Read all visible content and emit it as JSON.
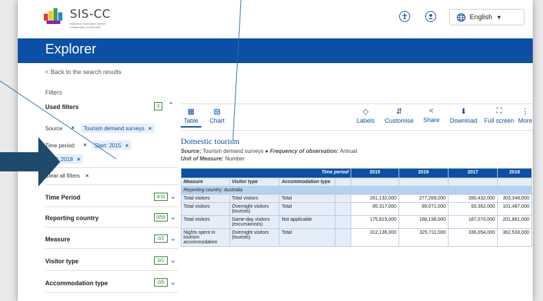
{
  "header": {
    "logo_title": "SIS-CC",
    "logo_subtitle": "Statistical Information System Collaboration Community",
    "language": "English",
    "accessibility_icon": "accessibility-icon",
    "account_icon": "account-icon",
    "globe_icon": "globe-icon"
  },
  "brand": "Explorer",
  "back_link": "< Back to the search results",
  "filters": {
    "title": "Filters",
    "used_filters_label": "Used filters",
    "used_filters_count": "3",
    "source_label": "Source",
    "source_chip": "Tourism demand surveys",
    "time_period_label": "Time period:",
    "start_chip": "Start: 2015",
    "end_chip": "End: 2018",
    "clear_all": "Clear all filters",
    "sections": [
      {
        "label": "Time Period",
        "count": "4/11"
      },
      {
        "label": "Reporting country",
        "count": "0/55"
      },
      {
        "label": "Measure",
        "count": "0/2"
      },
      {
        "label": "Visitor type",
        "count": "0/1"
      },
      {
        "label": "Accommodation type",
        "count": "0/5"
      }
    ]
  },
  "toolbar": {
    "table": "Table",
    "chart": "Chart",
    "labels": "Labels",
    "customise": "Customise",
    "share": "Share",
    "download": "Download",
    "fullscreen": "Full screen",
    "more": "More"
  },
  "dataset": {
    "title": "Domestic tourism",
    "source_label": "Source:",
    "source_value": "Tourism demand surveys",
    "freq_label": "Frequency of observation:",
    "freq_value": "Annual",
    "unit_label": "Unit of Measure:",
    "unit_value": "Number"
  },
  "table": {
    "time_period_header": "Time period",
    "years": [
      "2015",
      "2016",
      "2017",
      "2018"
    ],
    "col_measure": "Measure",
    "col_visitor": "Visitor type",
    "col_accommodation": "Accommodation type",
    "group_label": "Reporting country:",
    "group_value": "Australia",
    "rows": [
      {
        "measure": "Total visitors",
        "visitor": "Total visitors",
        "accom": "Total",
        "values": [
          "261,132,000",
          "277,269,000",
          "280,432,000",
          "303,348,000"
        ]
      },
      {
        "measure": "Total visitors",
        "visitor": "Overnight visitors (tourists)",
        "accom": "Total",
        "values": [
          "85,317,000",
          "89,071,000",
          "93,362,000",
          "101,487,000"
        ]
      },
      {
        "measure": "Total visitors",
        "visitor": "Same-day visitors (excursionists)",
        "accom": "Not applicable",
        "values": [
          "175,815,000",
          "188,198,000",
          "187,070,000",
          "201,861,000"
        ]
      },
      {
        "measure": "Nights spent in tourism accommodation",
        "visitor": "Overnight visitors (tourists)",
        "accom": "Total",
        "values": [
          "312,136,000",
          "325,711,000",
          "336,054,000",
          "362,533,000"
        ]
      }
    ]
  },
  "colors": {
    "brand_blue": "#0b4fa6",
    "annotation_arrow": "#1e4a6e"
  }
}
